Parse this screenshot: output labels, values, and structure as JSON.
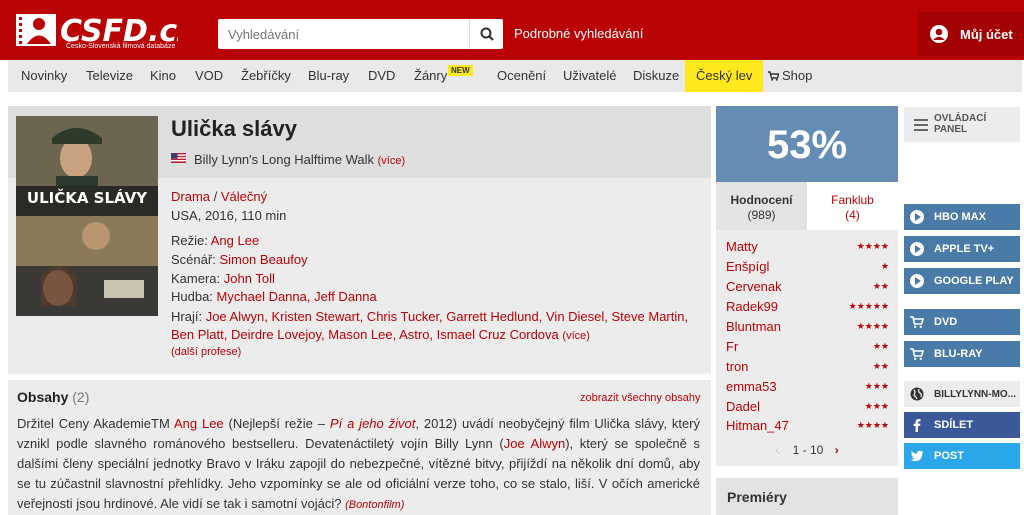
{
  "header": {
    "logo_text": "CSFD.cz",
    "logo_tagline": "Česko-Slovenská filmová databáze",
    "search_placeholder": "Vyhledávání",
    "advanced_search": "Podrobné vyhledávání",
    "account_label": "Můj účet"
  },
  "nav": {
    "items": [
      "Novinky",
      "Televize",
      "Kino",
      "VOD",
      "Žebříčky",
      "Blu-ray",
      "DVD",
      "Žánry",
      "Ocenění",
      "Uživatelé",
      "Diskuze",
      "Český lev",
      "Shop"
    ],
    "new_badge": "NEW"
  },
  "film": {
    "title": "Ulička slávy",
    "original_title": "Billy Lynn's Long Halftime Walk",
    "original_more": "(více)",
    "genre_1": "Drama",
    "genre_sep": " / ",
    "genre_2": "Válečný",
    "meta": "USA, 2016, 110 min",
    "director_label": "Režie:",
    "director": "Ang Lee",
    "writer_label": "Scénář:",
    "writer": "Simon Beaufoy",
    "camera_label": "Kamera:",
    "camera": "John Toll",
    "music_label": "Hudba:",
    "music": "Mychael Danna, Jeff Danna",
    "cast_label": "Hrají:",
    "cast": "Joe Alwyn, Kristen Stewart, Chris Tucker, Garrett Hedlund, Vin Diesel, Steve Martin, Ben Platt, Deirdre Lovejoy, Mason Lee, Astro, Ismael Cruz Cordova",
    "cast_more": "(více)",
    "other_professions": "(další profese)",
    "poster_title": "ULIČKA SLÁVY"
  },
  "plot": {
    "heading": "Obsahy",
    "count": "(2)",
    "show_all": "zobrazit všechny obsahy",
    "text_1": "Držitel Ceny AkademieTM ",
    "link_ang": "Ang Lee",
    "text_2": " (Nejlepší režie – ",
    "link_pi": "Pí a jeho život",
    "text_3": ", 2012) uvádí neobyčejný film Ulička slávy, který vznikl podle slavného románového bestselleru. Devatenáctiletý vojín Billy Lynn (",
    "link_joe": "Joe Alwyn",
    "text_4": "), který se společně s dalšími členy speciální jednotky Bravo v Iráku zapojil do nebezpečné, vítězné bitvy, přijíždí na několik dní domů, aby se tu zúčastnil slavnostní přehlídky. Jeho vzpomínky se ale od oficiální verze toho, co se stalo, liší. V očích americké veřejnosti jsou hrdinové. Ale vidí se tak i samotní vojáci? ",
    "source": "(Bontonfilm)"
  },
  "rating": {
    "percent": "53%",
    "tab_ratings_label": "Hodnocení",
    "tab_ratings_count": "(989)",
    "tab_fanclub_label": "Fanklub",
    "tab_fanclub_count": "(4)",
    "users": [
      {
        "name": "Matty",
        "stars": "★★★★",
        "value": 4
      },
      {
        "name": "Enšpígl",
        "stars": "★",
        "value": 1
      },
      {
        "name": "Cervenak",
        "stars": "★★",
        "value": 2
      },
      {
        "name": "Radek99",
        "stars": "★★★★★",
        "value": 5
      },
      {
        "name": "Bluntman",
        "stars": "★★★★",
        "value": 4
      },
      {
        "name": "Fr",
        "stars": "★★",
        "value": 2
      },
      {
        "name": "tron",
        "stars": "★★",
        "value": 2
      },
      {
        "name": "emma53",
        "stars": "★★★",
        "value": 3
      },
      {
        "name": "Dadel",
        "stars": "★★★",
        "value": 3
      },
      {
        "name": "Hitman_47",
        "stars": "★★★★",
        "value": 4
      }
    ],
    "pager_prev": "‹",
    "pager_range": "1 - 10",
    "pager_next": "›",
    "premiery": "Premiéry"
  },
  "sidebar": {
    "panel_line1": "OVLÁDACÍ",
    "panel_line2": "PANEL",
    "hbo": "HBO MAX",
    "apple": "APPLE TV+",
    "google": "GOOGLE PLAY",
    "dvd": "DVD",
    "bluray": "BLU-RAY",
    "website": "BILLYLYNN-MO...",
    "share": "SDÍLET",
    "post": "POST"
  },
  "colors": {
    "brand_red": "#ba0305",
    "rating_blue": "#658db4",
    "vod_blue": "#4a7ba8",
    "facebook": "#3b5998",
    "twitter": "#2ba6e9",
    "highlight_yellow": "#ffe81c"
  }
}
